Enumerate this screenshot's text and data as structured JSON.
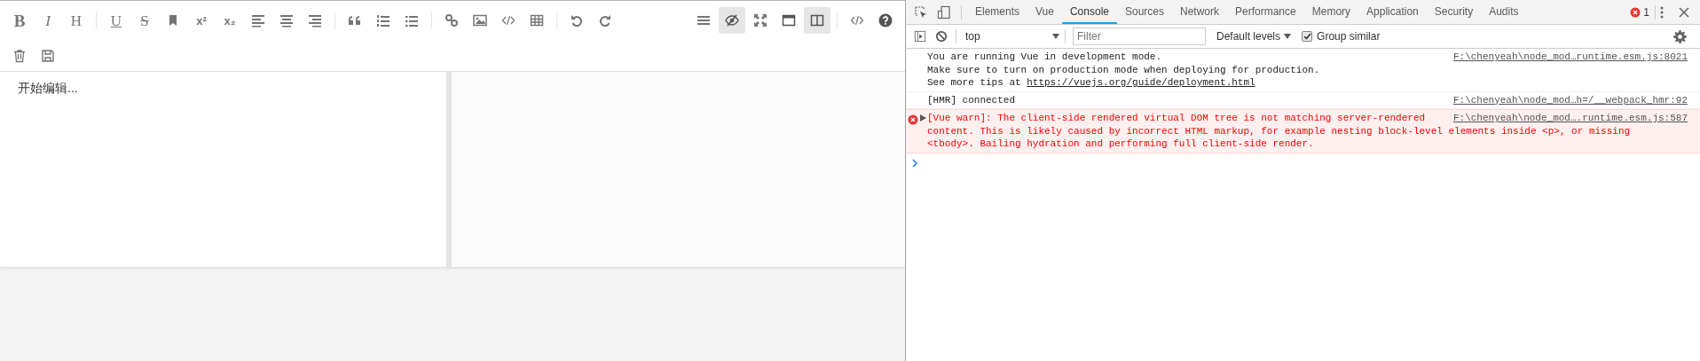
{
  "editor": {
    "toolbar": {
      "left_groups": [
        [
          {
            "kind": "bold",
            "label": "B"
          },
          {
            "kind": "italic",
            "label": "I"
          },
          {
            "kind": "heading",
            "label": "H"
          }
        ],
        [
          {
            "kind": "underline",
            "label": "U"
          },
          {
            "kind": "strike",
            "label": "S"
          },
          {
            "kind": "bookmark"
          },
          {
            "kind": "sup",
            "label": "x²"
          },
          {
            "kind": "sub",
            "label": "x₂"
          },
          {
            "kind": "alignleft"
          },
          {
            "kind": "aligncenter"
          },
          {
            "kind": "alignright"
          }
        ],
        [
          {
            "kind": "quote"
          },
          {
            "kind": "orderedlist"
          },
          {
            "kind": "bulletlist"
          }
        ],
        [
          {
            "kind": "link"
          },
          {
            "kind": "image"
          },
          {
            "kind": "code"
          },
          {
            "kind": "table"
          }
        ],
        [
          {
            "kind": "undo"
          },
          {
            "kind": "redo"
          }
        ]
      ],
      "second_row": [
        {
          "kind": "trash"
        },
        {
          "kind": "save"
        }
      ],
      "right_groups": [
        [
          {
            "kind": "menu",
            "selected": false
          },
          {
            "kind": "eyeoff",
            "selected": true
          },
          {
            "kind": "fullscreen",
            "selected": false
          },
          {
            "kind": "window",
            "selected": false
          },
          {
            "kind": "split",
            "selected": true
          }
        ],
        [
          {
            "kind": "code",
            "selected": false
          },
          {
            "kind": "help",
            "selected": false
          }
        ]
      ]
    },
    "placeholder": "开始编辑..."
  },
  "devtools": {
    "tabs": [
      {
        "label": "Elements",
        "selected": false
      },
      {
        "label": "Vue",
        "selected": false
      },
      {
        "label": "Console",
        "selected": true
      },
      {
        "label": "Sources",
        "selected": false
      },
      {
        "label": "Network",
        "selected": false
      },
      {
        "label": "Performance",
        "selected": false
      },
      {
        "label": "Memory",
        "selected": false
      },
      {
        "label": "Application",
        "selected": false
      },
      {
        "label": "Security",
        "selected": false
      },
      {
        "label": "Audits",
        "selected": false
      }
    ],
    "error_count": "1",
    "console_toolbar": {
      "context": "top",
      "filter_placeholder": "Filter",
      "levels": "Default levels",
      "group_similar": {
        "label": "Group similar",
        "checked": true
      }
    },
    "messages": [
      {
        "kind": "log",
        "lines": [
          "You are running Vue in development mode.",
          "Make sure to turn on production mode when deploying for production.",
          "See more tips at "
        ],
        "link": "https://vuejs.org/guide/deployment.html",
        "source": "F:\\chenyeah\\node_mod…runtime.esm.js:8021"
      },
      {
        "kind": "log",
        "lines": [
          "[HMR] connected"
        ],
        "source": "F:\\chenyeah\\node_mod…h=/__webpack_hmr:92"
      },
      {
        "kind": "error",
        "lines": [
          "[Vue warn]: The client-side rendered virtual DOM tree is not matching server-rendered",
          "content. This is likely caused by incorrect HTML markup, for example nesting block-level elements inside <p>, or missing",
          "<tbody>. Bailing hydration and performing full client-side render."
        ],
        "source": "F:\\chenyeah\\node_mod….runtime.esm.js:587"
      }
    ]
  }
}
